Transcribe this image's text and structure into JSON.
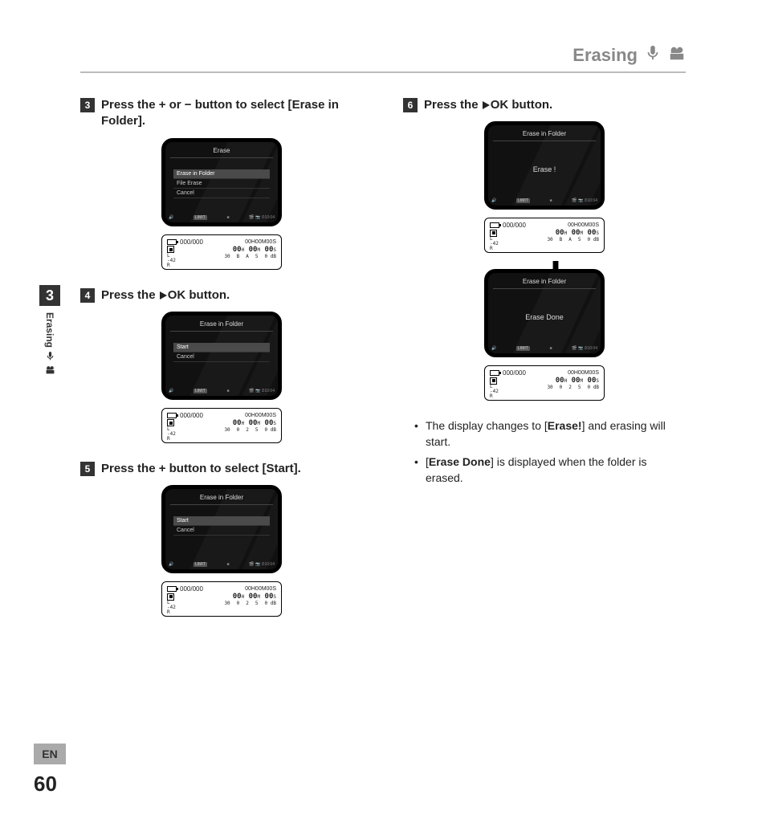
{
  "header": {
    "title": "Erasing"
  },
  "side": {
    "chapter": "3",
    "label": "Erasing"
  },
  "footer": {
    "lang": "EN",
    "page": "60"
  },
  "steps": {
    "s3": {
      "num": "3",
      "text_a": "Press the + or − button to select [",
      "bracket": "Erase in Folder",
      "text_b": "]."
    },
    "s4": {
      "num": "4",
      "text_a": "Press the ",
      "ok": "OK",
      "text_b": " button."
    },
    "s5": {
      "num": "5",
      "text_a": "Press the + button to select [",
      "bracket": "Start",
      "text_b": "]."
    },
    "s6": {
      "num": "6",
      "text_a": "Press the ",
      "ok": "OK",
      "text_b": " button."
    }
  },
  "lcd": {
    "erase_title": "Erase",
    "menu_erase": {
      "hl": "Erase in Folder",
      "i2": "File Erase",
      "i3": "Cancel"
    },
    "eif_title": "Erase in Folder",
    "menu_start": {
      "i1": "Start",
      "i2": "Cancel"
    },
    "menu_start_hl": {
      "hl": "Start",
      "i2": "Cancel"
    },
    "center_erase": "Erase !",
    "center_done": "Erase Done",
    "foot_limit": "LIMIT",
    "foot_time": "10:04"
  },
  "strip": {
    "counter": "000/000",
    "time": "00H00M00S",
    "h": "H",
    "m": "M",
    "s": "S",
    "l": "L",
    "r": "R",
    "d42": "-42",
    "d30": "30",
    "t0": "0",
    "t2": "2",
    "t5": "5",
    "td": "0 dB",
    "tB": "B",
    "tA": "A"
  },
  "bullets": {
    "b1a": "The display changes to [",
    "b1b": "Erase!",
    "b1c": "] and erasing will start.",
    "b2a": "[",
    "b2b": "Erase Done",
    "b2c": "] is displayed when the folder is erased."
  }
}
